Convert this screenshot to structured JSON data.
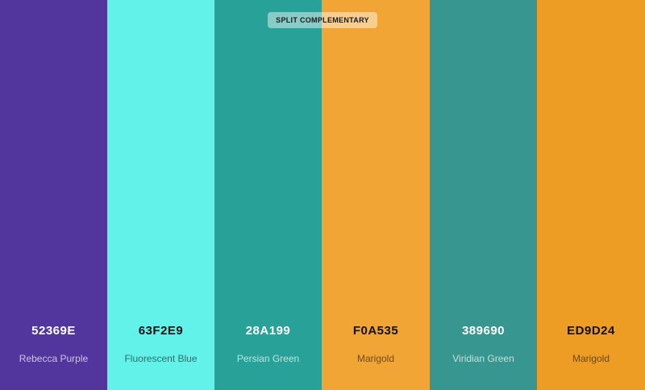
{
  "scheme": {
    "label": "SPLIT COMPLEMENTARY"
  },
  "swatches": [
    {
      "hex": "52369E",
      "name": "Rebecca Purple",
      "color": "#52369E",
      "text": "light"
    },
    {
      "hex": "63F2E9",
      "name": "Fluorescent Blue",
      "color": "#63F2E9",
      "text": "dark"
    },
    {
      "hex": "28A199",
      "name": "Persian Green",
      "color": "#28A199",
      "text": "light"
    },
    {
      "hex": "F0A535",
      "name": "Marigold",
      "color": "#F0A535",
      "text": "dark"
    },
    {
      "hex": "389690",
      "name": "Viridian Green",
      "color": "#389690",
      "text": "light"
    },
    {
      "hex": "ED9D24",
      "name": "Marigold",
      "color": "#ED9D24",
      "text": "dark"
    }
  ]
}
